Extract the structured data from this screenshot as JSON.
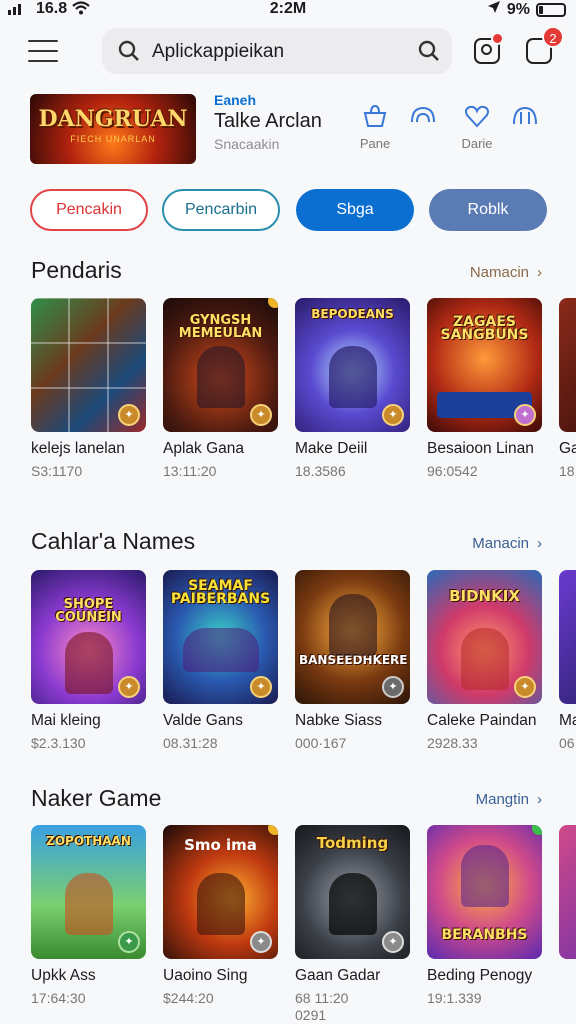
{
  "status": {
    "signal": "16.8",
    "time": "2:2M",
    "battery": "9%"
  },
  "header": {
    "search_text": "Aplickappieikan",
    "cart_badge": "2"
  },
  "featured": {
    "banner_title": "DANGRUAN",
    "banner_sub": "FIECH UNARLAN",
    "eyebrow": "Eaneh",
    "title": "Talke Arclan",
    "subtitle": "Snacaakin",
    "actions": [
      {
        "icon": "bag-icon",
        "label": "Pane"
      },
      {
        "icon": "rainbow-icon",
        "label": ""
      },
      {
        "icon": "heart-icon",
        "label": "Darie"
      },
      {
        "icon": "arch-icon",
        "label": ""
      }
    ]
  },
  "chips": [
    "Pencakin",
    "Pencarbin",
    "Sbga",
    "Roblk"
  ],
  "colors": {
    "accent": "#0a6fd1",
    "chip_red": "#e04444",
    "chip_teal": "#2a8fae",
    "chip_blue": "#5a7bb4",
    "badge": "#e53935"
  },
  "sections": [
    {
      "title": "Pendaris",
      "more": "Namacin",
      "cards": [
        {
          "name": "kelejs lanelan",
          "price": "S3:1170",
          "art": ""
        },
        {
          "name": "Aplak Gana",
          "price": "13:11:20",
          "art": "GYNGSH MEMEULAN"
        },
        {
          "name": "Make Deiil",
          "price": "18.3586",
          "art": "BEPODEANS"
        },
        {
          "name": "Besaioon Linan",
          "price": "96:0542",
          "art": "ZAGAES SANGBUNS"
        },
        {
          "name": "Ga",
          "price": "18",
          "art": ""
        }
      ]
    },
    {
      "title": "Cahlar'a Names",
      "more": "Manacin",
      "cards": [
        {
          "name": "Mai kleing",
          "price": "$2.3.130",
          "art": "SHOPE COUNEIN"
        },
        {
          "name": "Valde Gans",
          "price": "08.31:28",
          "art": "SEAMAF PAIBERBANS"
        },
        {
          "name": "Nabke Siass",
          "price": "000·167",
          "art": "BANSEEDHKERE"
        },
        {
          "name": "Caleke Paindan",
          "price": "2928.33",
          "art": "BIDNKIX"
        },
        {
          "name": "Ma",
          "price": "06",
          "art": ""
        }
      ]
    },
    {
      "title": "Naker Game",
      "more": "Mangtin",
      "cards": [
        {
          "name": "Upkk Ass",
          "price": "17:64:30",
          "art": "ZOPOTHAAN"
        },
        {
          "name": "Uaoino Sing",
          "price": "$244:20",
          "art": "Smo ima"
        },
        {
          "name": "Gaan Gadar",
          "price": "68 11:20",
          "price2": "0291",
          "art": "Todming"
        },
        {
          "name": "Beding Penogy",
          "price": "19:1.339",
          "art": "BERANBHS"
        },
        {
          "name": "",
          "price": "",
          "art": ""
        }
      ]
    }
  ]
}
